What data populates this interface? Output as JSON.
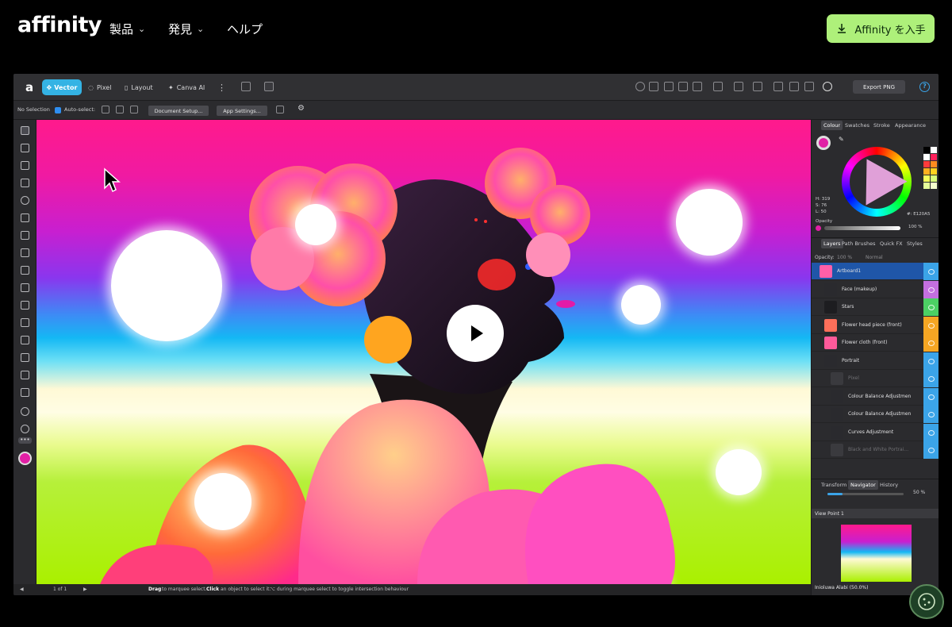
{
  "site_nav": {
    "logo": "affinity",
    "items": [
      {
        "label": "製品",
        "has_dropdown": true
      },
      {
        "label": "発見",
        "has_dropdown": true
      },
      {
        "label": "ヘルプ",
        "has_dropdown": false
      }
    ],
    "cta_label": "Affinity を入手",
    "cta_icon": "download-icon",
    "cta_color": "#aef07a"
  },
  "toolbar": {
    "logo": "a",
    "modes": [
      {
        "label": "Vector",
        "active": true,
        "icon": "vector-persona-icon"
      },
      {
        "label": "Pixel",
        "active": false,
        "icon": "pixel-persona-icon"
      },
      {
        "label": "Layout",
        "active": false,
        "icon": "layout-persona-icon"
      },
      {
        "label": "Canva AI",
        "active": false,
        "icon": "sparkle-icon"
      }
    ],
    "export_label": "Export PNG",
    "accent": "#34b3e4"
  },
  "context_bar": {
    "selection": "No Selection",
    "auto_select_label": "Auto-select:",
    "auto_select_checked": true,
    "document_setup": "Document Setup...",
    "app_settings": "App Settings..."
  },
  "canvas": {
    "play_icon": "play-icon",
    "cursor_icon": "arrow-cursor-icon"
  },
  "status_bar": {
    "page": "1 of 1",
    "hint_bold_1": "Drag",
    "hint_1": " to marquee select. ",
    "hint_bold_2": "Click",
    "hint_2": " an object to select it. ",
    "hint_3": "⌥ during marquee select to toggle intersection behaviour"
  },
  "colour_panel": {
    "tabs": [
      "Colour",
      "Swatches",
      "Stroke",
      "Appearance"
    ],
    "active_tab": "Colour",
    "h": "H: 319",
    "s": "S: 76",
    "l": "L: 50",
    "hex": "#: E120A5",
    "opacity_label": "Opacity",
    "opacity_value": "100 %",
    "current_color": "#e120a5",
    "swatches": [
      "#000000",
      "#ffffff",
      "#ffffff",
      "#ff1f5a",
      "#ff3b3b",
      "#ff8a1f",
      "#ffb01f",
      "#ffd21f",
      "#f4ff5a",
      "#d8ff7a",
      "#e6ff9a",
      "#f4ffcc"
    ]
  },
  "layers_panel": {
    "tabs": [
      "Layers",
      "Path Brushes",
      "Quick FX",
      "Styles"
    ],
    "active_tab": "Layers",
    "opacity_label": "Opacity:",
    "opacity_value": "100 %",
    "blend_mode": "Normal",
    "layers": [
      {
        "name": "Artboard1",
        "selected": true,
        "dim": false,
        "tag": "#3ba4e8"
      },
      {
        "name": "Face (makeup)",
        "selected": false,
        "dim": false,
        "tag": "#c46fe0"
      },
      {
        "name": "Stars",
        "selected": false,
        "dim": false,
        "tag": "#4cd064"
      },
      {
        "name": "Flower head piece (front)",
        "selected": false,
        "dim": false,
        "tag": "#f5a623"
      },
      {
        "name": "Flower cloth (front)",
        "selected": false,
        "dim": false,
        "tag": "#f5a623"
      },
      {
        "name": "Portrait",
        "selected": false,
        "dim": false,
        "tag": "#3ba4e8"
      },
      {
        "name": "Pixel",
        "selected": false,
        "dim": true,
        "tag": "#3ba4e8"
      },
      {
        "name": "Colour Balance Adjustmen",
        "selected": false,
        "dim": false,
        "tag": "#3ba4e8"
      },
      {
        "name": "Colour Balance Adjustmen",
        "selected": false,
        "dim": false,
        "tag": "#3ba4e8"
      },
      {
        "name": "Curves Adjustment",
        "selected": false,
        "dim": false,
        "tag": "#3ba4e8"
      },
      {
        "name": "Black and White Portrai...",
        "selected": false,
        "dim": true,
        "tag": "#3ba4e8"
      }
    ]
  },
  "navigator_panel": {
    "tabs": [
      "Transform",
      "Navigator",
      "History"
    ],
    "active_tab": "Navigator",
    "zoom_value": "50 %",
    "zoom_fraction": 0.2,
    "view_point": "View Point 1",
    "credit": "Inioluwa Alabi (50.0%)"
  },
  "cookie_icon": "cookie-icon"
}
